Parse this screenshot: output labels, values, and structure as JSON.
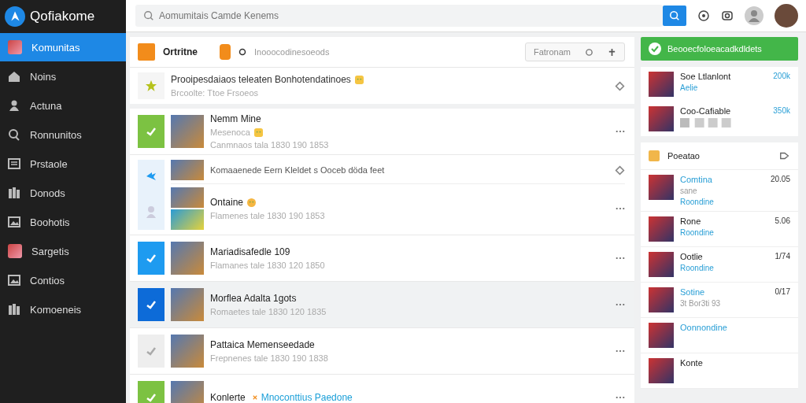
{
  "app": {
    "name": "Qofiakome"
  },
  "search": {
    "placeholder": "Aomumitais Camde Kenems"
  },
  "sidebar": {
    "items": [
      {
        "label": "Komunitas",
        "selected": true,
        "kind": "avatar"
      },
      {
        "label": "Noins",
        "selected": false,
        "kind": "home"
      },
      {
        "label": "Actuna",
        "selected": false,
        "kind": "person"
      },
      {
        "label": "Ronnunitos",
        "selected": false,
        "kind": "search"
      },
      {
        "label": "Prstaole",
        "selected": false,
        "kind": "list"
      },
      {
        "label": "Donods",
        "selected": false,
        "kind": "books"
      },
      {
        "label": "Boohotis",
        "selected": false,
        "kind": "image"
      },
      {
        "label": "Sargetis",
        "selected": false,
        "kind": "avatar"
      },
      {
        "label": "Contios",
        "selected": false,
        "kind": "image"
      },
      {
        "label": "Komoeneis",
        "selected": false,
        "kind": "books"
      }
    ]
  },
  "feed": {
    "header": {
      "title": "Ortritne",
      "subtitle": "Inooocodinesoeods",
      "filter": "Fatronam"
    },
    "pinned": {
      "title": "Prooipesdaiaos teleaten Bonhotendatinoes",
      "meta": "Brcoolte: Ttoe Frsoeos"
    },
    "group": {
      "title": "Komaaenede Eern Kleldet s Ooceb döda feet",
      "name": "Ontaine",
      "meta": "Flamenes tale 1830 190 1853"
    },
    "posts": [
      {
        "title": "Nemm Mine",
        "tag": "Mesenoca",
        "meta": "Canmnaos tala 1830 190 1853",
        "color": "#7cc242",
        "highlighted": false
      },
      {
        "title": "Mariadisafedle 109",
        "meta": "Flamanes tale 1830 120 1850",
        "color": "#1e9bf0",
        "highlighted": false
      },
      {
        "title": "Morflea Adalta 1gots",
        "meta": "Romaetes tale 1830 120 1835",
        "color": "#0d6bd8",
        "highlighted": true
      },
      {
        "title": "Pattaica Memenseedade",
        "meta": "Frepnenes tale 1830 190 1838",
        "color": "#eeeeee",
        "highlighted": false
      },
      {
        "title": "Konlerte",
        "link": "Mnoconttius Paedone",
        "color": "#7cc242",
        "highlighted": false
      }
    ]
  },
  "promo": {
    "label": "Beooecfoloeacadkdldets"
  },
  "top_list": [
    {
      "name": "Soe Ltlanlont",
      "count": "200k",
      "sub": "Aelie"
    },
    {
      "name": "Coo-Cafiable",
      "count": "350k"
    }
  ],
  "panel": {
    "title": "Poeatao",
    "items": [
      {
        "name": "Comtina",
        "time": "20.05",
        "sub": "sane",
        "link": "Roondine",
        "linked_name": true
      },
      {
        "name": "Rone",
        "time": "5.06",
        "link": "Roondine",
        "linked_name": false
      },
      {
        "name": "Ootlie",
        "time": "1/74",
        "link": "Roondine",
        "linked_name": false
      },
      {
        "name": "Sotine",
        "time": "0/17",
        "sub": "3t Bor3ti 93",
        "linked_name": true
      },
      {
        "name": "Oonnondine",
        "linked_name": true
      },
      {
        "name": "Konte",
        "linked_name": false
      }
    ]
  }
}
